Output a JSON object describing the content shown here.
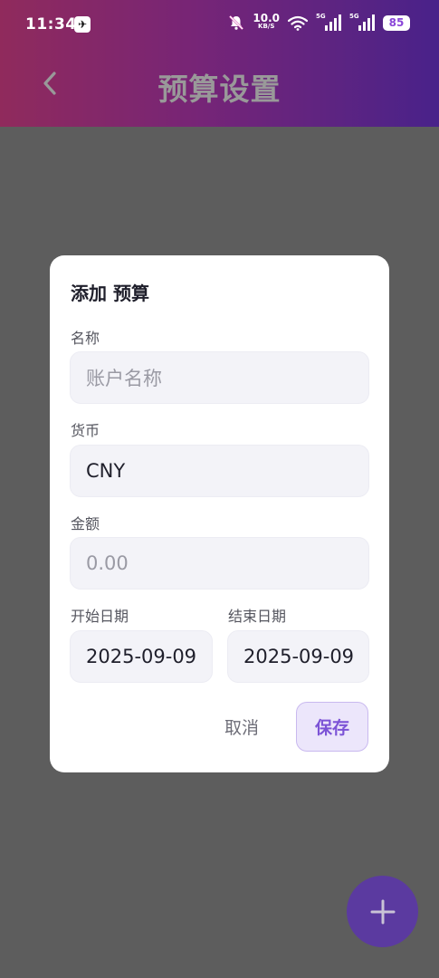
{
  "status_bar": {
    "time": "11:34",
    "app_icon": "notification-app-icon",
    "speed_value": "10.0",
    "speed_unit": "KB/S",
    "network_label_1": "5G",
    "network_label_2": "5G",
    "battery": "85"
  },
  "header": {
    "title": "预算设置",
    "back_icon": "chevron-left-icon"
  },
  "dialog": {
    "title": "添加 预算",
    "name_label": "名称",
    "name_placeholder": "账户名称",
    "currency_label": "货币",
    "currency_value": "CNY",
    "amount_label": "金额",
    "amount_placeholder": "0.00",
    "start_date_label": "开始日期",
    "start_date_value": "2025-09-09",
    "end_date_label": "结束日期",
    "end_date_value": "2025-09-09",
    "cancel_label": "取消",
    "save_label": "保存"
  },
  "fab": {
    "icon": "plus-icon"
  },
  "colors": {
    "accent": "#7c53d6",
    "fab": "#5b3aa0",
    "gradient_start": "#f0479a",
    "gradient_end": "#7a3ae6"
  }
}
